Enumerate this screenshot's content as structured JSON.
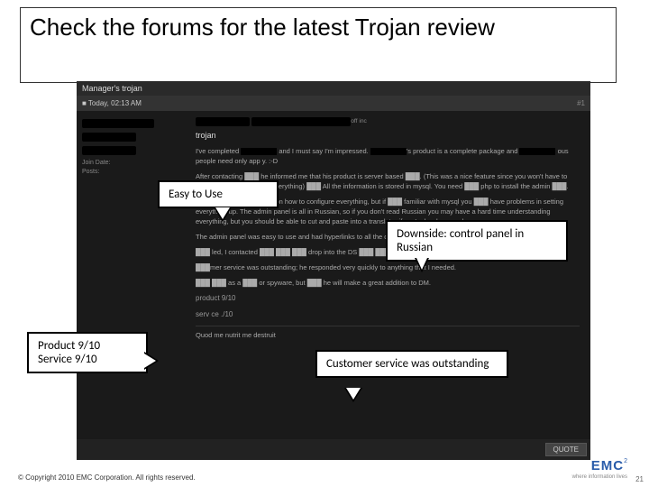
{
  "title": "Check the forums for the latest Trojan review",
  "forum": {
    "thread_title": "Manager's trojan",
    "post_date": "Today, 02:13 AM",
    "post_number": "#1",
    "side": {
      "join_label": "Join Date:",
      "posts_label": "Posts:"
    },
    "body": {
      "heading": "trojan",
      "p1a": "I've completed",
      "p1b": "and I must say I'm impressed.",
      "p1c": "'s product is a complete package and",
      "p1d": "ous people need only app y. :-D",
      "p2": "After contacting ███ he informed me that his product is server based ███. (This was a nice feature since you won't have to worry about getting ███ everything) ███ All the information is stored in mysql. You need ███ php to install the admin ███.",
      "p3": "███ provides instructions on how to configure everything, but if ███ familiar with mysql you ███ have problems in setting everything up. The admin panel is all in Russian, so if you don't read Russian you may have a hard time understanding everything, but you should be able to cut and paste into a translator if you're hard pressed.",
      "p4": "The admin panel was easy to use and had hyperlinks to all the different features.",
      "p5": "███ led, I contacted ███ ███ ███ drop into the DS ███ ███ ███ and was not detected by my ███ ███ ███.",
      "p6": "███mer service was outstanding; he responded very quickly to anything that I needed.",
      "p7": "███ ███ as a ███ or spyware, but ███ he will make a great addition to DM.",
      "rating1": "product 9/10",
      "rating2": "serv ce ./10",
      "motto": "Quod me nutrit me destruit",
      "quote": "QUOTE"
    }
  },
  "callouts": {
    "c1": "Easy to Use",
    "c2": "Downside: control panel in Russian",
    "c3a": "Product 9/10",
    "c3b": "Service 9/10",
    "c4": "Customer service was outstanding"
  },
  "footer": "© Copyright 2010 EMC Corporation. All rights reserved.",
  "logo": {
    "brand": "EMC",
    "sup": "2",
    "tagline": "where information lives"
  },
  "pagenum": "21"
}
